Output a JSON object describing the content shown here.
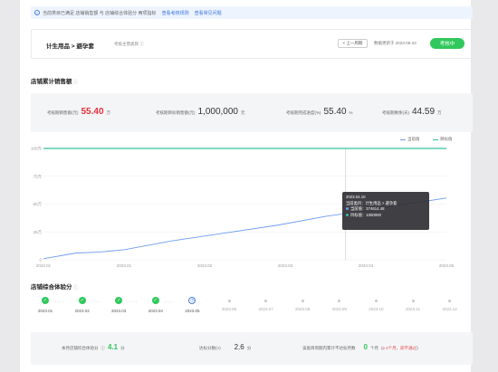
{
  "notice": {
    "text": "当前类目已满足 店铺销售额 与 店铺综合体验分 两项指标",
    "link1": "查看考核规则",
    "link2": "查看常见问题"
  },
  "header": {
    "breadcrumb": "计生用品 > 避孕套",
    "sub_label": "考核主营类目",
    "prev_button": "< 上一周期",
    "updated": "数据更新于 2023-05-23",
    "status": "考核中"
  },
  "sales": {
    "title": "店铺累计销售额",
    "stats": [
      {
        "label": "考核期销售额(元)",
        "value": "55.40",
        "unit": "万",
        "color": "#e8323c"
      },
      {
        "label": "考核期目标销售额(元)",
        "value": "1,000,000",
        "unit": "元",
        "color": "#333333"
      },
      {
        "label": "考核期完成进度(%)",
        "value": "55.40",
        "unit": "%",
        "color": "#333333"
      },
      {
        "label": "考核期剩余(天)",
        "value": "44.59",
        "unit": "万",
        "color": "#333333"
      }
    ]
  },
  "chart_data": {
    "type": "line",
    "x": [
      "2023.01",
      "2023.01",
      "2023.02",
      "2023.03",
      "2023.04",
      "2023.05"
    ],
    "y_ticks": [
      "100万",
      "75万",
      "50万",
      "25万",
      "0"
    ],
    "ylim": [
      0,
      100
    ],
    "legend": [
      "当前值",
      "目标值"
    ],
    "series": [
      {
        "name": "当前值",
        "color": "#6f9cf0",
        "x": [
          0,
          0.08,
          0.14,
          0.2,
          0.32,
          0.45,
          0.58,
          0.7,
          0.82,
          0.9,
          1.0
        ],
        "values": [
          1,
          6,
          7,
          9,
          17,
          24,
          31,
          39,
          45,
          50,
          55.4
        ]
      },
      {
        "name": "目标值",
        "color": "#30c0a0",
        "x": [
          0,
          1
        ],
        "values": [
          100,
          100
        ]
      }
    ],
    "tooltip": {
      "date": "2023.04.10",
      "category": "当前类目：计生用品 > 避孕套",
      "current": "当前值：374614.48",
      "target": "目标值：1000000"
    }
  },
  "experience": {
    "title": "店铺综合体验分",
    "months": [
      {
        "label": "2023.01",
        "state": "done"
      },
      {
        "label": "2023.02",
        "state": "done"
      },
      {
        "label": "2023.03",
        "state": "done"
      },
      {
        "label": "2023.04",
        "state": "done"
      },
      {
        "label": "2023.05",
        "state": "current"
      },
      {
        "label": "2023.06",
        "state": "todo"
      },
      {
        "label": "2023.07",
        "state": "todo"
      },
      {
        "label": "2023.08",
        "state": "todo"
      },
      {
        "label": "2023.09",
        "state": "todo"
      },
      {
        "label": "2023.10",
        "state": "todo"
      },
      {
        "label": "2023.11",
        "state": "todo"
      },
      {
        "label": "2023.12",
        "state": "todo"
      }
    ],
    "score_label": "本月店铺综合体验分",
    "score_value": "4.1",
    "score_unit": "分",
    "target_label": "达标分数(>)",
    "target_value": "2.6",
    "target_unit": "分",
    "fail_label": "该类目周期内累计不达标月数",
    "fail_value": "0",
    "fail_unit": "个月",
    "fail_rule": "(",
    "fail_rule_red": "≥ 4个月，即不通过",
    "fail_rule_end": ")"
  }
}
